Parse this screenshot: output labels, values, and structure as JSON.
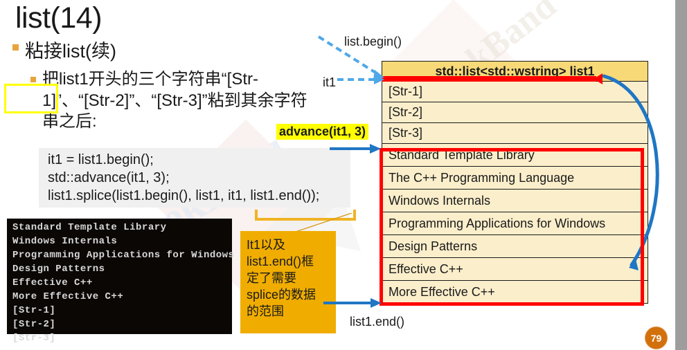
{
  "slide": {
    "title": "list(14)",
    "page_number": "79",
    "watermark": "GeekBand"
  },
  "bullets": {
    "level1": "粘接list(续)",
    "level2": "把list1开头的三个字符串“[Str-1]”、“[Str-2]”、“[Str-3]”粘到其余字符串之后:"
  },
  "code": {
    "line1": "it1 = list1.begin();",
    "line2": "std::advance(it1, 3);",
    "line3": "list1.splice(list1.begin(), list1, it1, list1.end());"
  },
  "console": {
    "lines": [
      "Standard Template Library",
      "Windows Internals",
      "Programming Applications for Windows",
      "Design Patterns",
      "Effective C++",
      "More Effective C++",
      "[Str-1]",
      "[Str-2]",
      "[Str-3]"
    ]
  },
  "note": {
    "line1": "It1以及",
    "line2": "list1.end()框",
    "line3": "定了需要",
    "line4": "splice的数据",
    "line5": "的范围"
  },
  "diagram": {
    "table_header": "std::list<std::wstring> list1",
    "rows": [
      "[Str-1]",
      "[Str-2]",
      "[Str-3]",
      "Standard Template Library",
      "The C++ Programming Language",
      "Windows Internals",
      "Programming Applications for Windows",
      "Design Patterns",
      "Effective C++",
      "More Effective C++"
    ],
    "label_begin": "list.begin()",
    "label_it1": "it1",
    "label_advance": "advance(it1, 3)",
    "label_end": "list1.end()"
  },
  "colors": {
    "accent_orange": "#e8a33d",
    "highlight_yellow": "#ffff00",
    "note_orange": "#f0ad00",
    "red": "#ff0000",
    "blue": "#1f76c4",
    "dashed_blue": "#4fa8e8",
    "header_gold": "#f7d978",
    "row_cream": "#fbeecb",
    "badge_orange": "#d2700c",
    "right_strip_gray": "#9d9d9d"
  }
}
